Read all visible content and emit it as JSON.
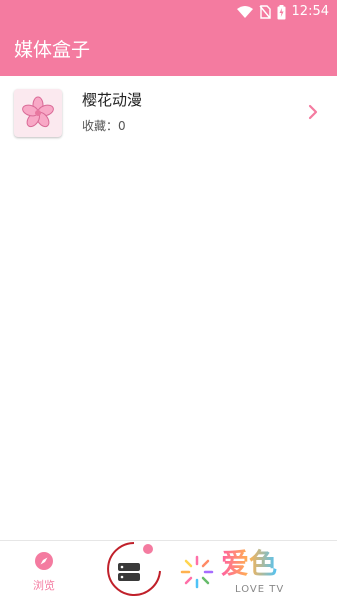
{
  "status_bar": {
    "time": "12:54",
    "icons": [
      "wifi-icon",
      "no-sim-icon",
      "battery-charging-icon"
    ]
  },
  "app_bar": {
    "title": "媒体盒子"
  },
  "list": {
    "items": [
      {
        "name": "樱花动漫",
        "favorites": "收藏：0",
        "icon": "sakura-icon"
      }
    ]
  },
  "bottom_nav": {
    "browse_label": "浏览",
    "browse_icon": "compass-icon",
    "box_icon": "storage-icon"
  },
  "watermark": {
    "text": "爱色",
    "sub": "LOVE TV"
  },
  "colors": {
    "accent": "#f47ba0",
    "accent_dark": "#e85a86"
  }
}
